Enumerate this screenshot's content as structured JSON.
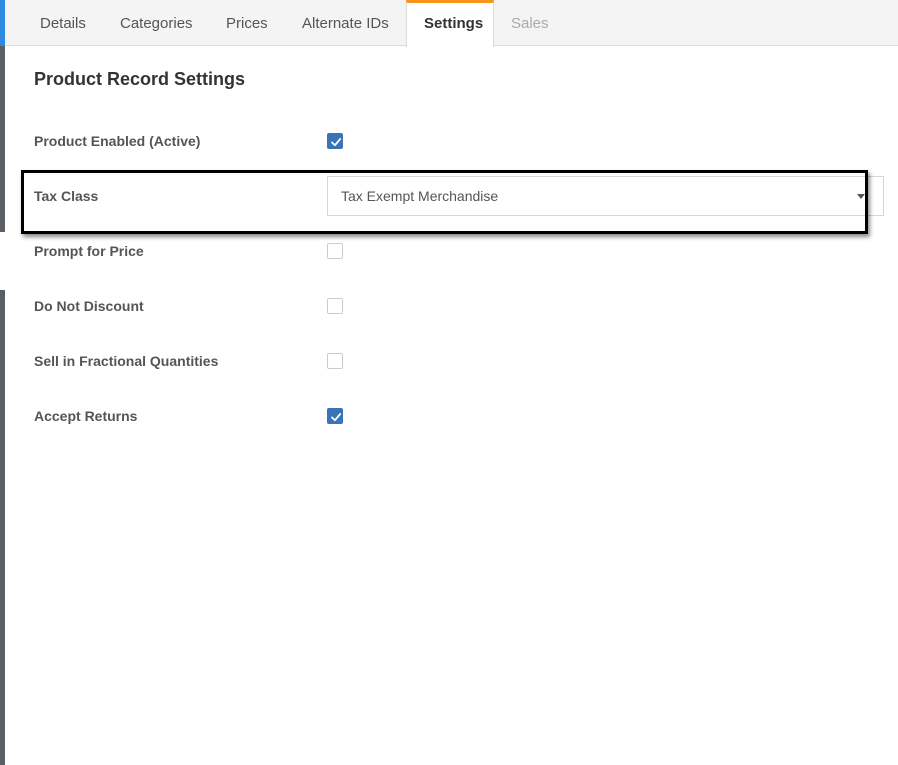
{
  "tabs": [
    {
      "label": "Details"
    },
    {
      "label": "Categories"
    },
    {
      "label": "Prices"
    },
    {
      "label": "Alternate IDs"
    },
    {
      "label": "Settings"
    },
    {
      "label": "Sales"
    }
  ],
  "active_tab": "Settings",
  "accent_color": "#f7941e",
  "checkbox_color": "#3a74b7",
  "section_title": "Product Record Settings",
  "settings": {
    "product_enabled": {
      "label": "Product Enabled (Active)",
      "checked": true
    },
    "tax_class": {
      "label": "Tax Class",
      "value": "Tax Exempt Merchandise"
    },
    "prompt_for_price": {
      "label": "Prompt for Price",
      "checked": false
    },
    "do_not_discount": {
      "label": "Do Not Discount",
      "checked": false
    },
    "sell_fractional": {
      "label": "Sell in Fractional Quantities",
      "checked": false
    },
    "accept_returns": {
      "label": "Accept Returns",
      "checked": true
    }
  }
}
